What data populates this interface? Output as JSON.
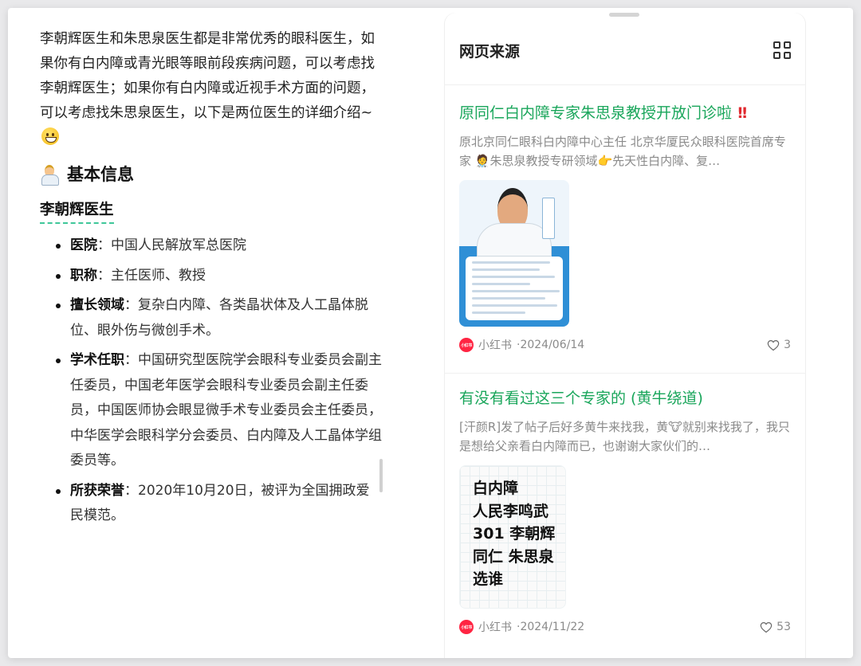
{
  "answer": {
    "intro": "李朝辉医生和朱思泉医生都是非常优秀的眼科医生，如果你有白内障或青光眼等眼前段疾病问题，可以考虑找李朝辉医生；如果你有白内障或近视手术方面的问题，可以考虑找朱思泉医生，以下是两位医生的详细介绍~",
    "section_heading": "基本信息",
    "doctor_name": "李朝辉医生",
    "facts": [
      {
        "key": "医院",
        "sep": "：",
        "value": "中国人民解放军总医院"
      },
      {
        "key": "职称",
        "sep": "：",
        "value": "主任医师、教授"
      },
      {
        "key": "擅长领域",
        "sep": "：",
        "value": "复杂白内障、各类晶状体及人工晶体脱位、眼外伤与微创手术。"
      },
      {
        "key": "学术任职",
        "sep": "：",
        "value": "中国研究型医院学会眼科专业委员会副主任委员，中国老年医学会眼科专业委员会副主任委员，中国医师协会眼显微手术专业委员会主任委员，中华医学会眼科学分会委员、白内障及人工晶体学组委员等。"
      },
      {
        "key": "所获荣誉",
        "sep": "：",
        "value": "2020年10月20日，被评为全国拥政爱民模范。"
      }
    ]
  },
  "sources_panel": {
    "title": "网页来源",
    "cards": [
      {
        "title": "原同仁白内障专家朱思泉教授开放门诊啦",
        "title_suffix": "!!",
        "snippet": "原北京同仁眼科白内障中心主任 北京华厦民众眼科医院首席专家 🧑‍⚕️朱思泉教授专研领域👉先天性白内障、复…",
        "source_logo_text": "小红书",
        "source": "小红书",
        "date": "·2024/06/14",
        "likes": "3"
      },
      {
        "title": "有没有看过这三个专家的 (黄牛绕道)",
        "title_suffix": "",
        "snippet": "[汗颜R]发了帖子后好多黄牛来找我，黄🐮就别来找我了，我只是想给父亲看白内障而已，也谢谢大家伙们的…",
        "thumb_lines": [
          "白内障",
          "人民李鸣武",
          "301 李朝辉",
          "同仁 朱思泉",
          "选谁"
        ],
        "source_logo_text": "小红书",
        "source": "小红书",
        "date": "·2024/11/22",
        "likes": "53"
      }
    ]
  }
}
